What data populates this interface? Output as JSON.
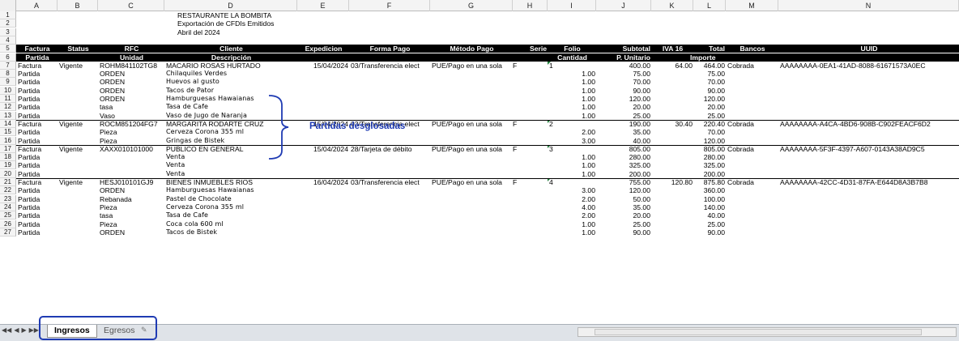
{
  "columns": [
    "A",
    "B",
    "C",
    "D",
    "E",
    "F",
    "G",
    "H",
    "I",
    "J",
    "K",
    "L",
    "M",
    "N"
  ],
  "title": {
    "line1": "RESTAURANTE LA BOMBITA",
    "line2": "Exportación de CFDIs Emitidos",
    "line3": "Abril del 2024"
  },
  "header_row5": {
    "a": "Factura",
    "b": "Status",
    "c": "RFC",
    "d": "Cliente",
    "e": "Expedicion",
    "f": "Forma Pago",
    "g": "Método Pago",
    "h": "Serie",
    "i": "Folio",
    "j": "Subtotal",
    "k": "IVA 16",
    "l": "Total",
    "m": "Bancos",
    "n": "UUID"
  },
  "header_row6": {
    "a": "Partida",
    "c": "Unidad",
    "d": "Descripción",
    "i": "Cantidad",
    "j": "P. Unitario",
    "l": "Importe"
  },
  "rows": [
    {
      "n": "7",
      "a": "Factura",
      "b": "Vigente",
      "c": "ROHM841102TG8",
      "d": "MACARIO ROSAS HURTADO",
      "e": "15/04/2024",
      "f": "03/Transferencia elect",
      "g": "PUE/Pago en una sola",
      "h": "F",
      "i": "1",
      "j": "400.00",
      "k": "64.00",
      "l": "464.00",
      "m": "Cobrada",
      "nn": "AAAAAAAA-0EA1-41AD-8088-61671573A0EC"
    },
    {
      "n": "8",
      "a": "Partida",
      "c": "ORDEN",
      "d": "Chilaquiles Verdes",
      "i": "1.00",
      "j": "75.00",
      "l": "75.00"
    },
    {
      "n": "9",
      "a": "Partida",
      "c": "ORDEN",
      "d": "Huevos al gusto",
      "i": "1.00",
      "j": "70.00",
      "l": "70.00"
    },
    {
      "n": "10",
      "a": "Partida",
      "c": "ORDEN",
      "d": "Tacos de Pator",
      "i": "1.00",
      "j": "90.00",
      "l": "90.00"
    },
    {
      "n": "11",
      "a": "Partida",
      "c": "ORDEN",
      "d": "Hamburguesas Hawaianas",
      "i": "1.00",
      "j": "120.00",
      "l": "120.00"
    },
    {
      "n": "12",
      "a": "Partida",
      "c": "tasa",
      "d": "Tasa de Cafe",
      "i": "1.00",
      "j": "20.00",
      "l": "20.00"
    },
    {
      "n": "13",
      "a": "Partida",
      "c": "Vaso",
      "d": "Vaso de Jugo de Naranja",
      "i": "1.00",
      "j": "25.00",
      "l": "25.00"
    },
    {
      "n": "14",
      "a": "Factura",
      "b": "Vigente",
      "c": "ROCM851204FG7",
      "d": "MARGARITA RODARTE CRUZ",
      "e": "15/04/2024",
      "f": "03/Transferencia elect",
      "g": "PUE/Pago en una sola",
      "h": "F",
      "i": "2",
      "j": "190.00",
      "k": "30.40",
      "l": "220.40",
      "m": "Cobrada",
      "nn": "AAAAAAAA-A4CA-4BD6-908B-C902FEACF6D2"
    },
    {
      "n": "15",
      "a": "Partida",
      "c": "Pieza",
      "d": "Cerveza Corona 355 ml",
      "i": "2.00",
      "j": "35.00",
      "l": "70.00"
    },
    {
      "n": "16",
      "a": "Partida",
      "c": "Pieza",
      "d": "Gringas de Bistek",
      "i": "3.00",
      "j": "40.00",
      "l": "120.00"
    },
    {
      "n": "17",
      "a": "Factura",
      "b": "Vigente",
      "c": "XAXX010101000",
      "d": "PUBLICO EN GENERAL",
      "e": "15/04/2024",
      "f": "28/Tarjeta de débito",
      "g": "PUE/Pago en una sola",
      "h": "F",
      "i": "3",
      "j": "805.00",
      "k": "",
      "l": "805.00",
      "m": "Cobrada",
      "nn": "AAAAAAAA-5F3F-4397-A607-0143A38AD9C5"
    },
    {
      "n": "18",
      "a": "Partida",
      "c": "",
      "d": "Venta",
      "i": "1.00",
      "j": "280.00",
      "l": "280.00"
    },
    {
      "n": "19",
      "a": "Partida",
      "c": "",
      "d": "Venta",
      "i": "1.00",
      "j": "325.00",
      "l": "325.00"
    },
    {
      "n": "20",
      "a": "Partida",
      "c": "",
      "d": "Venta",
      "i": "1.00",
      "j": "200.00",
      "l": "200.00"
    },
    {
      "n": "21",
      "a": "Factura",
      "b": "Vigente",
      "c": "HESJ010101GJ9",
      "d": "BIENES INMUEBLES RIOS",
      "e": "16/04/2024",
      "f": "03/Transferencia elect",
      "g": "PUE/Pago en una sola",
      "h": "F",
      "i": "4",
      "j": "755.00",
      "k": "120.80",
      "l": "875.80",
      "m": "Cobrada",
      "nn": "AAAAAAAA-42CC-4D31-87FA-E644D8A3B7B8"
    },
    {
      "n": "22",
      "a": "Partida",
      "c": "ORDEN",
      "d": "Hamburguesas Hawaianas",
      "i": "3.00",
      "j": "120.00",
      "l": "360.00"
    },
    {
      "n": "23",
      "a": "Partida",
      "c": "Rebanada",
      "d": "Pastel de Chocolate",
      "i": "2.00",
      "j": "50.00",
      "l": "100.00"
    },
    {
      "n": "24",
      "a": "Partida",
      "c": "Pieza",
      "d": "Cerveza Corona 355 ml",
      "i": "4.00",
      "j": "35.00",
      "l": "140.00"
    },
    {
      "n": "25",
      "a": "Partida",
      "c": "tasa",
      "d": "Tasa de Cafe",
      "i": "2.00",
      "j": "20.00",
      "l": "40.00"
    },
    {
      "n": "26",
      "a": "Partida",
      "c": "Pieza",
      "d": "Coca cola 600 ml",
      "i": "1.00",
      "j": "25.00",
      "l": "25.00"
    },
    {
      "n": "27",
      "a": "Partida",
      "c": "ORDEN",
      "d": "Tacos de Bistek",
      "i": "1.00",
      "j": "90.00",
      "l": "90.00"
    }
  ],
  "annotation": "Partidas desglosadas",
  "tabs": {
    "active": "Ingresos",
    "inactive": "Egresos"
  },
  "colors": {
    "annotation": "#1f3bb3",
    "header_bg": "#000000",
    "flag": "#1e7f3a"
  }
}
